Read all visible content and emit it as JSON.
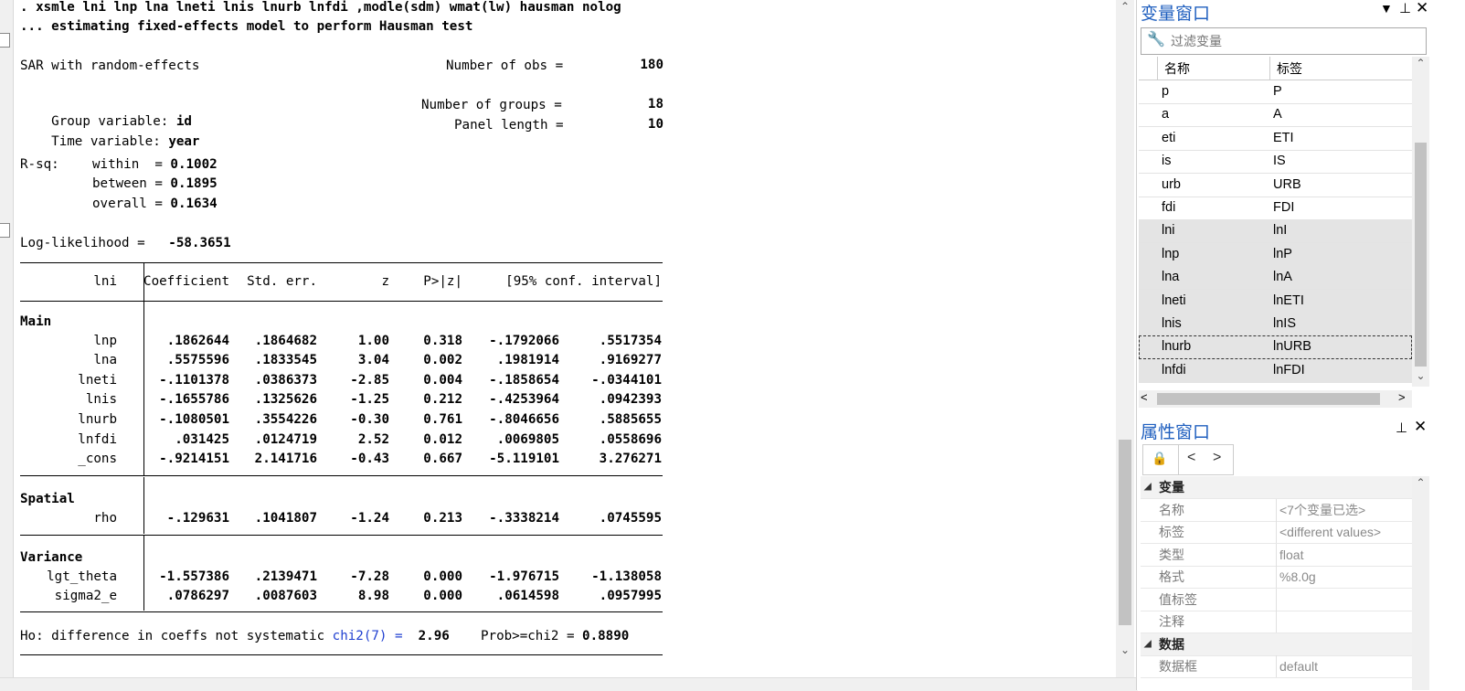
{
  "command_lines": [
    ". xsmle lni lnp lna lneti lnis lnurb lnfdi ,modle(sdm) wmat(lw) hausman nolog",
    "... estimating fixed-effects model to perform Hausman test"
  ],
  "header": {
    "model": "SAR with random-effects",
    "nobs_label": "Number of obs =",
    "nobs": "180",
    "group_label": "Group variable:",
    "group_var": "id",
    "ngroups_label": "Number of groups =",
    "ngroups": "18",
    "time_label": "Time variable:",
    "time_var": "year",
    "panel_label": "Panel length =",
    "panel_len": "10",
    "rsq_label": "R-sq:",
    "within_label": "within  =",
    "within": "0.1002",
    "between_label": "between =",
    "between": "0.1895",
    "overall_label": "overall =",
    "overall": "0.1634",
    "ll_label": "Log-likelihood =",
    "ll": "-58.3651"
  },
  "table": {
    "depvar": "lni",
    "columns": [
      "Coefficient",
      "Std. err.",
      "z",
      "P>|z|",
      "[95% conf. interval]"
    ],
    "sections": [
      {
        "name": "Main",
        "rows": [
          {
            "var": "lnp",
            "vals": [
              ".1862644",
              ".1864682",
              "1.00",
              "0.318",
              "-.1792066",
              ".5517354"
            ]
          },
          {
            "var": "lna",
            "vals": [
              ".5575596",
              ".1833545",
              "3.04",
              "0.002",
              ".1981914",
              ".9169277"
            ]
          },
          {
            "var": "lneti",
            "vals": [
              "-.1101378",
              ".0386373",
              "-2.85",
              "0.004",
              "-.1858654",
              "-.0344101"
            ]
          },
          {
            "var": "lnis",
            "vals": [
              "-.1655786",
              ".1325626",
              "-1.25",
              "0.212",
              "-.4253964",
              ".0942393"
            ]
          },
          {
            "var": "lnurb",
            "vals": [
              "-.1080501",
              ".3554226",
              "-0.30",
              "0.761",
              "-.8046656",
              ".5885655"
            ]
          },
          {
            "var": "lnfdi",
            "vals": [
              ".031425",
              ".0124719",
              "2.52",
              "0.012",
              ".0069805",
              ".0558696"
            ]
          },
          {
            "var": "_cons",
            "vals": [
              "-.9214151",
              "2.141716",
              "-0.43",
              "0.667",
              "-5.119101",
              "3.276271"
            ]
          }
        ]
      },
      {
        "name": "Spatial",
        "rows": [
          {
            "var": "rho",
            "vals": [
              "-.129631",
              ".1041807",
              "-1.24",
              "0.213",
              "-.3338214",
              ".0745595"
            ]
          }
        ]
      },
      {
        "name": "Variance",
        "rows": [
          {
            "var": "lgt_theta",
            "vals": [
              "-1.557386",
              ".2139471",
              "-7.28",
              "0.000",
              "-1.976715",
              "-1.138058"
            ]
          },
          {
            "var": "sigma2_e",
            "vals": [
              ".0786297",
              ".0087603",
              "8.98",
              "0.000",
              ".0614598",
              ".0957995"
            ]
          }
        ]
      }
    ]
  },
  "hausman": {
    "prefix": "Ho: difference in coeffs not systematic",
    "chi2_label": "chi2(7) =",
    "chi2": "2.96",
    "prob_label": "Prob>=chi2 =",
    "prob": "0.8890"
  },
  "var_window": {
    "title": "变量窗口",
    "filter_placeholder": "过滤变量",
    "col_name": "名称",
    "col_label": "标签",
    "rows": [
      {
        "name": "p",
        "label": "P",
        "selected": false
      },
      {
        "name": "a",
        "label": "A",
        "selected": false
      },
      {
        "name": "eti",
        "label": "ETI",
        "selected": false
      },
      {
        "name": "is",
        "label": "IS",
        "selected": false
      },
      {
        "name": "urb",
        "label": "URB",
        "selected": false
      },
      {
        "name": "fdi",
        "label": "FDI",
        "selected": false
      },
      {
        "name": "lni",
        "label": "lnI",
        "selected": true
      },
      {
        "name": "lnp",
        "label": "lnP",
        "selected": true
      },
      {
        "name": "lna",
        "label": "lnA",
        "selected": true
      },
      {
        "name": "lneti",
        "label": "lnETI",
        "selected": true
      },
      {
        "name": "lnis",
        "label": "lnIS",
        "selected": true
      },
      {
        "name": "lnurb",
        "label": "lnURB",
        "selected": true
      },
      {
        "name": "lnfdi",
        "label": "lnFDI",
        "selected": true
      }
    ]
  },
  "prop_window": {
    "title": "属性窗口",
    "groups": [
      {
        "name": "变量",
        "items": [
          {
            "key": "名称",
            "value": "<7个变量已选>"
          },
          {
            "key": "标签",
            "value": "<different values>"
          },
          {
            "key": "类型",
            "value": "float"
          },
          {
            "key": "格式",
            "value": "%8.0g"
          },
          {
            "key": "值标签",
            "value": ""
          },
          {
            "key": "注释",
            "value": ""
          }
        ]
      },
      {
        "name": "数据",
        "items": [
          {
            "key": "数据框",
            "value": "default"
          }
        ]
      }
    ]
  },
  "icons": {
    "filter": "filter-icon",
    "pin": "pin-icon",
    "close": "close-icon",
    "wrench": "wrench-icon",
    "lock": "lock-icon"
  }
}
